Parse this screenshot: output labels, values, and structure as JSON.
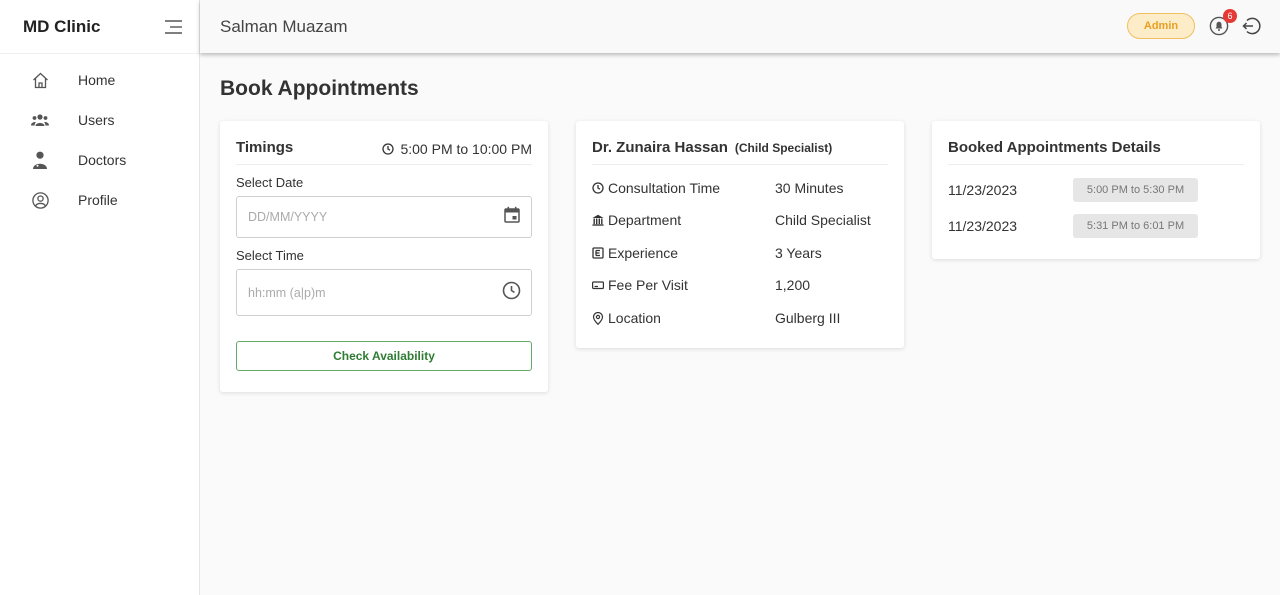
{
  "brand": "MD Clinic",
  "sidebar": {
    "items": [
      {
        "label": "Home",
        "icon": "home-icon"
      },
      {
        "label": "Users",
        "icon": "users-icon"
      },
      {
        "label": "Doctors",
        "icon": "doctor-icon"
      },
      {
        "label": "Profile",
        "icon": "profile-icon"
      }
    ]
  },
  "topbar": {
    "user_name": "Salman Muazam",
    "role_badge": "Admin",
    "notification_count": "6"
  },
  "page": {
    "title": "Book Appointments"
  },
  "timings": {
    "title": "Timings",
    "range": "5:00 PM to 10:00 PM",
    "date_label": "Select Date",
    "date_placeholder": "DD/MM/YYYY",
    "time_label": "Select Time",
    "time_placeholder": "hh:mm (a|p)m",
    "check_button": "Check Availability"
  },
  "doctor": {
    "name": "Dr. Zunaira Hassan",
    "specialty": "(Child Specialist)",
    "details": [
      {
        "key": "Consultation Time",
        "value": "30 Minutes",
        "icon": "clock-icon"
      },
      {
        "key": "Department",
        "value": "Child Specialist",
        "icon": "building-icon"
      },
      {
        "key": "Experience",
        "value": "3 Years",
        "icon": "experience-icon"
      },
      {
        "key": "Fee Per Visit",
        "value": "1,200",
        "icon": "cash-icon"
      },
      {
        "key": "Location",
        "value": "Gulberg III",
        "icon": "location-pin-icon"
      }
    ]
  },
  "booked": {
    "title": "Booked Appointments Details",
    "appointments": [
      {
        "date": "11/23/2023",
        "slot": "5:00 PM to 5:30 PM"
      },
      {
        "date": "11/23/2023",
        "slot": "5:31 PM to 6:01 PM"
      }
    ]
  },
  "colors": {
    "admin_badge_bg": "#fdecc8",
    "admin_badge_text": "#e8a020",
    "notification_badge": "#e53935",
    "check_button_text": "#2e7d32"
  }
}
